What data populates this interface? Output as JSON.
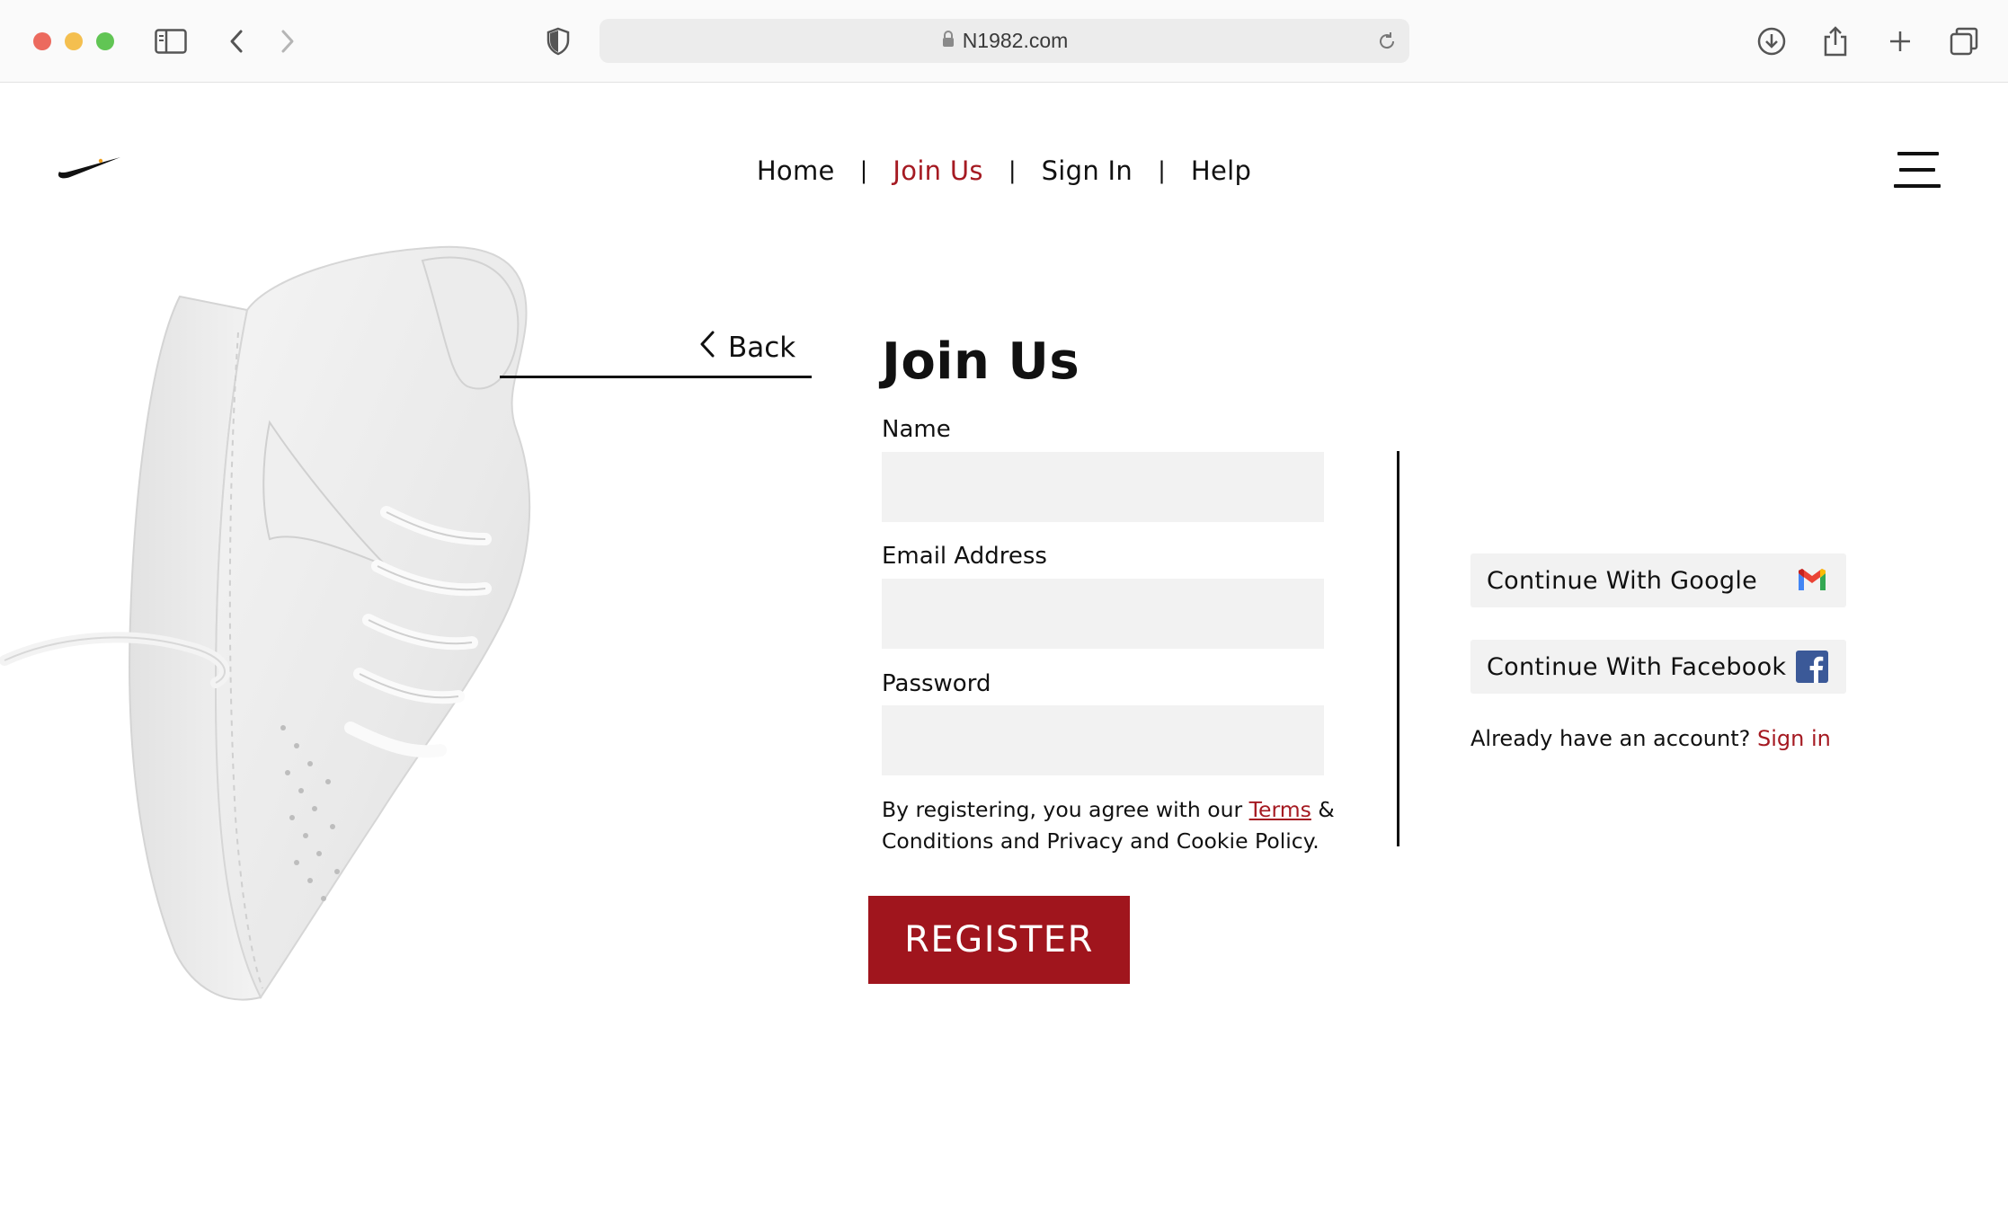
{
  "browser": {
    "url": "N1982.com"
  },
  "nav": {
    "items": [
      {
        "label": "Home"
      },
      {
        "label": "Join Us"
      },
      {
        "label": "Sign In"
      },
      {
        "label": "Help"
      }
    ],
    "separator": "|",
    "active_color": "#a51a22"
  },
  "back": {
    "label": "Back"
  },
  "form": {
    "title": "Join Us",
    "name_label": "Name",
    "email_label": "Email Address",
    "password_label": "Password",
    "name_value": "",
    "email_value": "",
    "password_value": "",
    "terms_prefix": "By registering, you agree with our ",
    "terms_link": "Terms",
    "terms_suffix": " & Conditions and Privacy and Cookie Policy.",
    "register_label": "REGISTER",
    "register_color": "#a0151d"
  },
  "social": {
    "google_label": "Continue With Google",
    "google_icon": "gmail-icon",
    "facebook_label": "Continue With Facebook",
    "facebook_icon": "facebook-icon",
    "have_account_text": "Already have an account? ",
    "sign_in_link": "Sign in"
  }
}
